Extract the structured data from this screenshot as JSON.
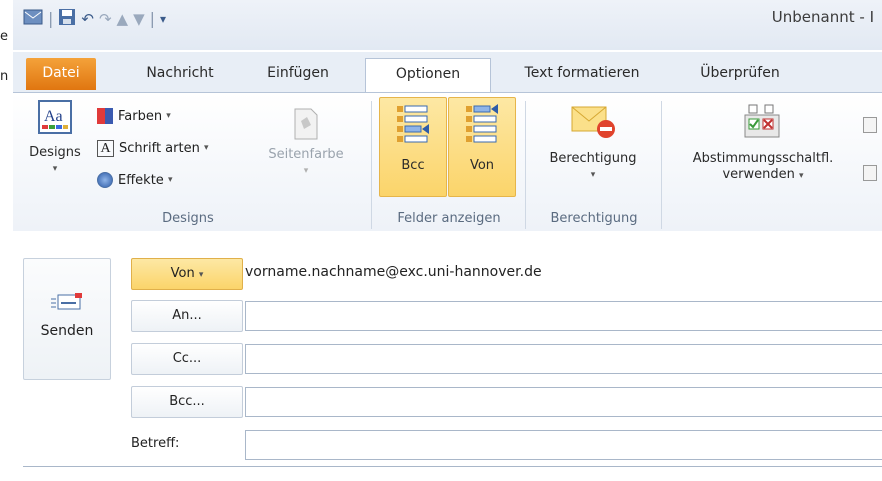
{
  "edge": {
    "line1": "e",
    "line2": "n"
  },
  "window": {
    "title": "Unbenannt - I"
  },
  "tabs": [
    {
      "label": "Datei"
    },
    {
      "label": "Nachricht"
    },
    {
      "label": "Einfügen"
    },
    {
      "label": "Optionen"
    },
    {
      "label": "Text formatieren"
    },
    {
      "label": "Überprüfen"
    }
  ],
  "ribbon": {
    "designs": {
      "button": "Designs",
      "farben": "Farben",
      "schriftarten": "Schrift arten",
      "effekte": "Effekte",
      "seitenfarbe": "Seitenfarbe",
      "group": "Designs"
    },
    "felder": {
      "bcc": "Bcc",
      "von": "Von",
      "group": "Felder anzeigen"
    },
    "berechtigung": {
      "button": "Berechtigung",
      "group": "Berechtigung"
    },
    "abstimmung": {
      "line1": "Abstimmungsschaltfl.",
      "line2": "verwenden"
    }
  },
  "form": {
    "send": "Senden",
    "von": "Von",
    "an": "An...",
    "cc": "Cc...",
    "bcc": "Bcc...",
    "betreff": "Betreff:",
    "sender_email": "vorname.nachname@exc.uni-hannover.de"
  },
  "colors": {
    "accent": "#e07610",
    "highlight": "#fbd46a"
  }
}
